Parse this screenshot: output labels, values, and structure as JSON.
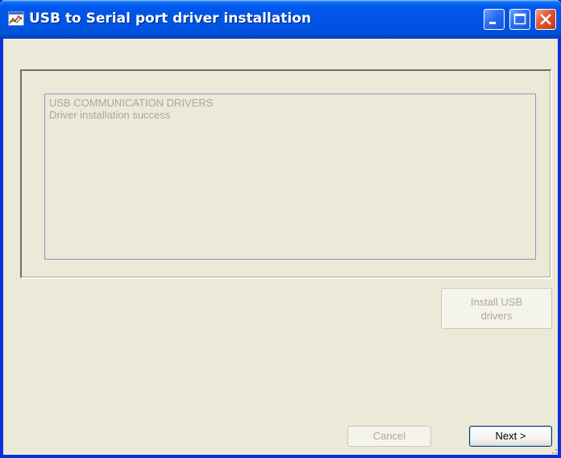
{
  "window": {
    "title": "USB to Serial port driver installation",
    "icons": {
      "app": "chart-window-icon",
      "minimize": "minimize-icon",
      "maximize": "maximize-icon",
      "close": "close-icon",
      "grip": "resize-grip-icon"
    }
  },
  "log": {
    "lines": [
      "USB COMMUNICATION DRIVERS",
      "Driver installation success"
    ]
  },
  "buttons": {
    "install_line1": "Install USB",
    "install_line2": "drivers",
    "cancel": "Cancel",
    "next": "Next >"
  },
  "colors": {
    "title_bar": "#0054e3",
    "window_bg": "#ece9d8",
    "disabled_text": "#aca899",
    "close_button": "#e3532d"
  }
}
